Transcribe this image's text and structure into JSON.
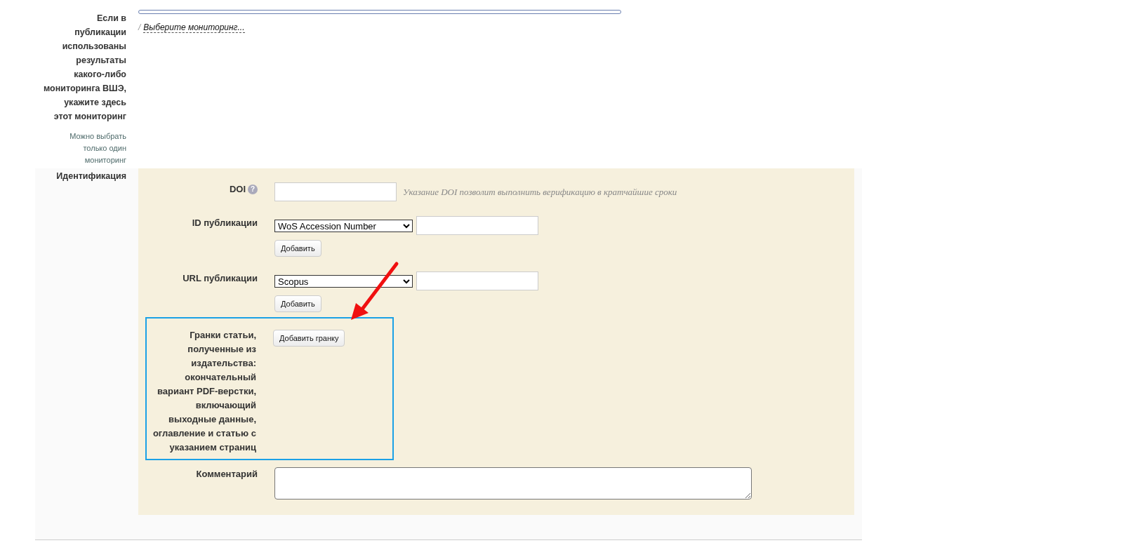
{
  "monitoring": {
    "label": "Если в публикации использованы результаты какого-либо мониторинга ВШЭ, укажите здесь этот мониторинг",
    "note": "Можно выбрать только один мониторинг",
    "separator": "/",
    "link": "Выберите мониторинг..."
  },
  "identification": {
    "title": "Идентификация",
    "fields": [
      {
        "kind": "text",
        "label": "DOI",
        "help": "?",
        "hint": "Указание DOI позволит выполнить верификацию в кратчайшие сроки",
        "highlighted": false
      },
      {
        "kind": "select_add",
        "label": "ID публикации",
        "select_value": "WoS Accession Number",
        "button": "Добавить",
        "highlighted": false
      },
      {
        "kind": "select_add",
        "label": "URL публикации",
        "select_value": "Scopus",
        "button": "Добавить",
        "highlighted": false
      },
      {
        "kind": "button",
        "label": "Гранки статьи, полученные из издательства: окончательный вариант PDF-верстки, включающий выходные данные, оглавление и статью с указанием страниц",
        "button": "Добавить гранку",
        "highlighted": true
      },
      {
        "kind": "textarea",
        "label": "Комментарий",
        "highlighted": false
      }
    ]
  }
}
